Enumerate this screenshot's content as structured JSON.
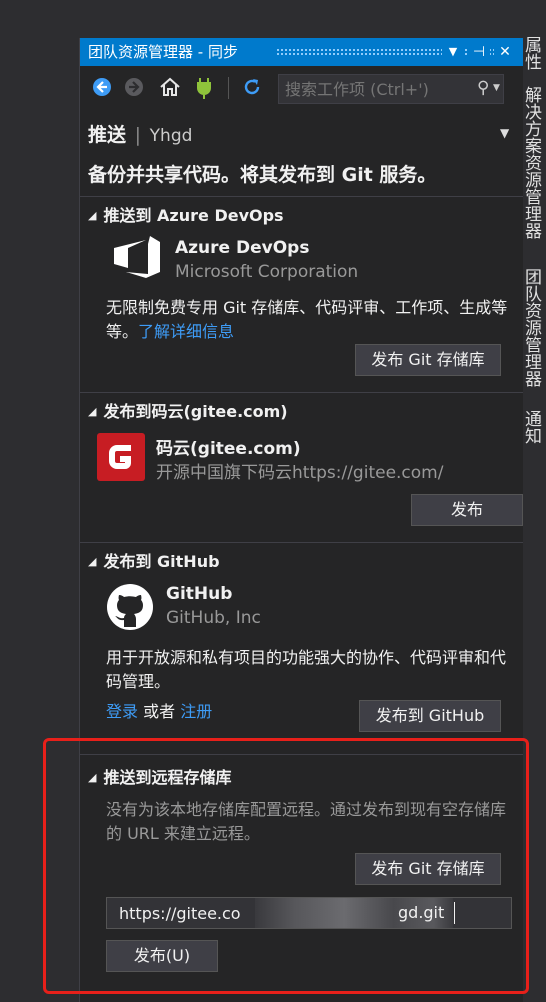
{
  "window": {
    "title": "团队资源管理器 - 同步",
    "dropdown_icon": "▼",
    "pin_icon": "⊣",
    "close_icon": "✕"
  },
  "toolbar": {
    "search_placeholder": "搜索工作项 (Ctrl+')"
  },
  "page": {
    "heading": "推送",
    "user": "Yhgd",
    "separator": "|",
    "intro": "备份并共享代码。将其发布到 Git 服务。"
  },
  "sections": {
    "azure": {
      "header": "推送到 Azure DevOps",
      "name": "Azure DevOps",
      "company": "Microsoft Corporation",
      "desc": "无限制免费专用 Git 存储库、代码评审、工作项、生成等等。",
      "link": "了解详细信息",
      "button": "发布 Git 存储库"
    },
    "gitee": {
      "header": "发布到码云(gitee.com)",
      "name": "码云(gitee.com)",
      "subtitle": "开源中国旗下码云https://gitee.com/",
      "button": "发布"
    },
    "github": {
      "header": "发布到 GitHub",
      "name": "GitHub",
      "company": "GitHub, Inc",
      "desc": "用于开放源和私有项目的功能强大的协作、代码评审和代码管理。",
      "login": "登录",
      "or": "或者",
      "register": "注册",
      "button": "发布到 GitHub"
    },
    "remote": {
      "header": "推送到远程存储库",
      "desc": "没有为该本地存储库配置远程。通过发布到现有空存储库的 URL 来建立远程。",
      "button": "发布 Git 存储库",
      "url_value": "https://gitee.co",
      "url_tail": "gd.git",
      "publish_button": "发布(U)"
    }
  },
  "side_tabs": [
    "属性",
    "解决方案资源管理器",
    "团队资源管理器",
    "通知"
  ],
  "colors": {
    "accent": "#007acc",
    "link": "#3e9cf6",
    "highlight": "#e8201a",
    "gitee_red": "#c71d23"
  }
}
